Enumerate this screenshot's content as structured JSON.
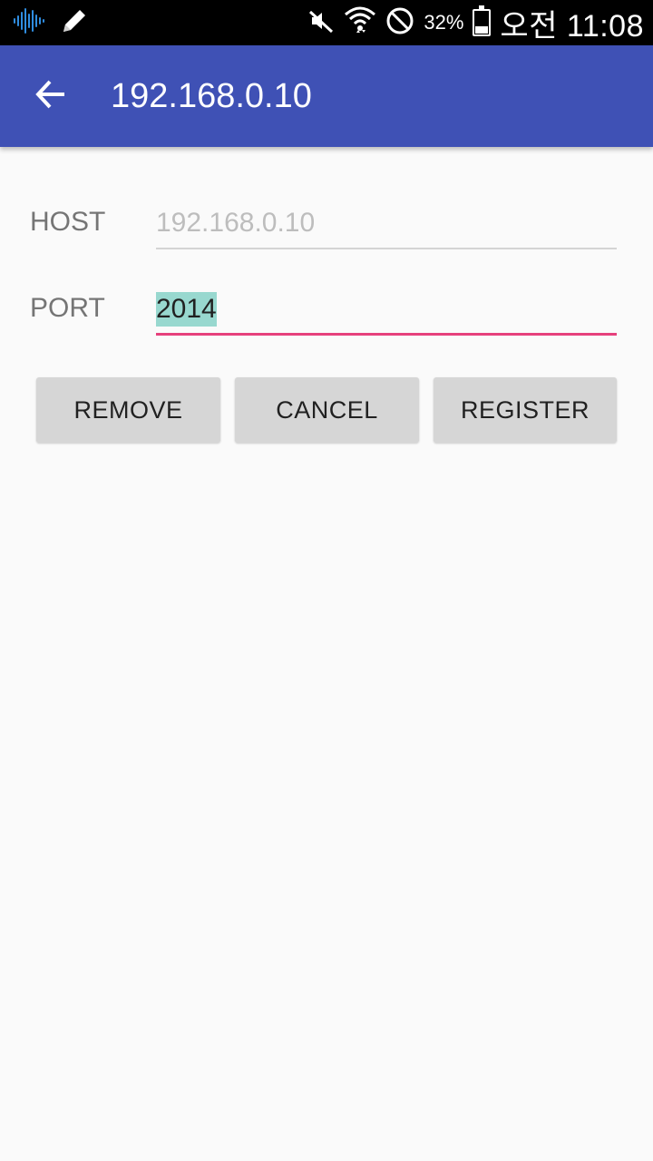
{
  "status_bar": {
    "left_icons": [
      "sound-wave-icon",
      "pencil-icon"
    ],
    "right_icons": [
      "mute-icon",
      "wifi-icon",
      "do-not-disturb-icon",
      "battery-icon"
    ],
    "battery_percent": "32%",
    "battery_level": 0.32,
    "time": "오전 11:08"
  },
  "app_bar": {
    "title": "192.168.0.10",
    "back_icon": "arrow-back-icon",
    "color": "#3f51b5"
  },
  "form": {
    "host": {
      "label": "HOST",
      "placeholder": "192.168.0.10",
      "value": ""
    },
    "port": {
      "label": "PORT",
      "value": "2014"
    },
    "accent": "#e6407c",
    "selection_color": "#98d8cf"
  },
  "buttons": {
    "remove": "REMOVE",
    "cancel": "CANCEL",
    "register": "REGISTER"
  }
}
